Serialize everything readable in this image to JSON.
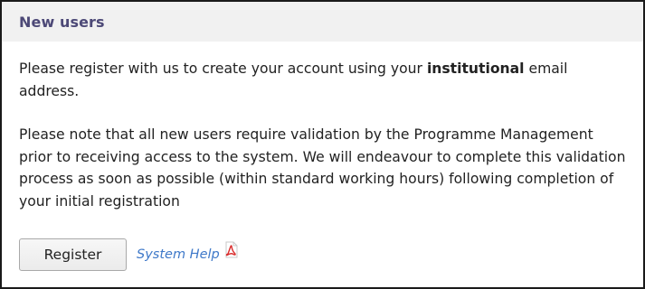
{
  "panel": {
    "title": "New users",
    "intro": {
      "before": "Please register with us to create your account using your ",
      "emphasis": "institutional",
      "after": " email address."
    },
    "note": "Please note that all new users require validation by the Programme Management prior to receiving access to the system. We will endeavour to complete this validation process as soon as possible (within standard working hours) following completion of your initial registration"
  },
  "actions": {
    "register_label": "Register",
    "help_link_label": "System Help",
    "help_icon": "pdf-icon"
  },
  "colors": {
    "title": "#4d4977",
    "header_bg": "#f1f1f1",
    "link": "#3f79c9",
    "pdf_icon": "#d92b2b",
    "border": "#1a1a1a"
  }
}
